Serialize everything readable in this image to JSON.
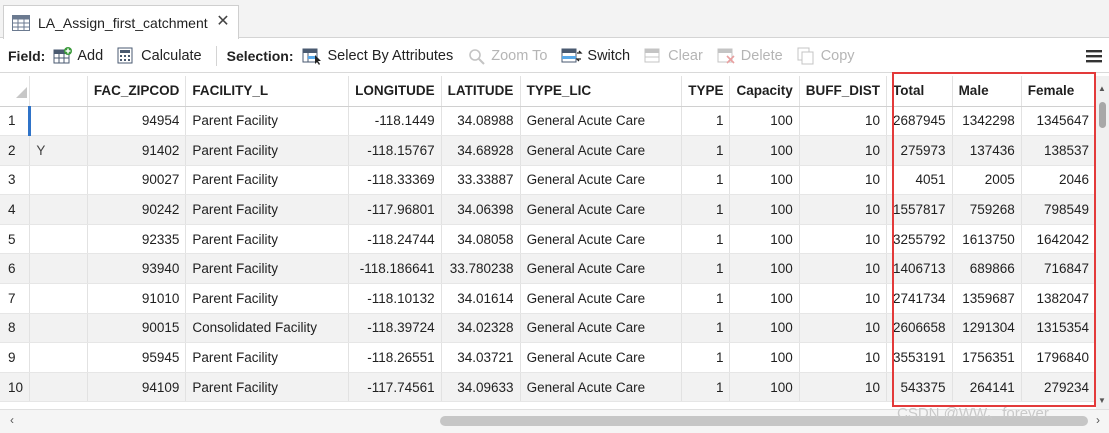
{
  "tab": {
    "title": "LA_Assign_first_catchment"
  },
  "toolbar": {
    "field_label": "Field:",
    "add": "Add",
    "calculate": "Calculate",
    "selection_label": "Selection:",
    "select_by_attributes": "Select By Attributes",
    "zoom_to": "Zoom To",
    "switch": "Switch",
    "clear": "Clear",
    "delete": "Delete",
    "copy": "Copy"
  },
  "table": {
    "columns": [
      "",
      "",
      "FAC_ZIPCOD",
      "FACILITY_L",
      "LONGITUDE",
      "LATITUDE",
      "TYPE_LIC",
      "TYPE",
      "Capacity",
      "BUFF_DIST",
      "Total",
      "Male",
      "Female"
    ],
    "rows": [
      [
        "1",
        "",
        "94954",
        "Parent Facility",
        "-118.1449",
        "34.08988",
        "General Acute Care",
        "1",
        "100",
        "10",
        "2687945",
        "1342298",
        "1345647"
      ],
      [
        "2",
        "Y",
        "91402",
        "Parent Facility",
        "-118.15767",
        "34.68928",
        "General Acute Care",
        "1",
        "100",
        "10",
        "275973",
        "137436",
        "138537"
      ],
      [
        "3",
        "",
        "90027",
        "Parent Facility",
        "-118.33369",
        "33.33887",
        "General Acute Care",
        "1",
        "100",
        "10",
        "4051",
        "2005",
        "2046"
      ],
      [
        "4",
        "",
        "90242",
        "Parent Facility",
        "-117.96801",
        "34.06398",
        "General Acute Care",
        "1",
        "100",
        "10",
        "1557817",
        "759268",
        "798549"
      ],
      [
        "5",
        "",
        "92335",
        "Parent Facility",
        "-118.24744",
        "34.08058",
        "General Acute Care",
        "1",
        "100",
        "10",
        "3255792",
        "1613750",
        "1642042"
      ],
      [
        "6",
        "",
        "93940",
        "Parent Facility",
        "-118.186641",
        "33.780238",
        "General Acute Care",
        "1",
        "100",
        "10",
        "1406713",
        "689866",
        "716847"
      ],
      [
        "7",
        "",
        "91010",
        "Parent Facility",
        "-118.10132",
        "34.01614",
        "General Acute Care",
        "1",
        "100",
        "10",
        "2741734",
        "1359687",
        "1382047"
      ],
      [
        "8",
        "",
        "90015",
        "Consolidated Facility",
        "-118.39724",
        "34.02328",
        "General Acute Care",
        "1",
        "100",
        "10",
        "2606658",
        "1291304",
        "1315354"
      ],
      [
        "9",
        "",
        "95945",
        "Parent Facility",
        "-118.26551",
        "34.03721",
        "General Acute Care",
        "1",
        "100",
        "10",
        "3553191",
        "1756351",
        "1796840"
      ],
      [
        "10",
        "",
        "94109",
        "Parent Facility",
        "-117.74561",
        "34.09633",
        "General Acute Care",
        "1",
        "100",
        "10",
        "543375",
        "264141",
        "279234"
      ]
    ]
  },
  "watermark": "CSDN @WW、forever",
  "colors": {
    "highlight": "#e33a3a",
    "row_indicator": "#2f73c8",
    "alt_row": "#f2f2f2"
  }
}
